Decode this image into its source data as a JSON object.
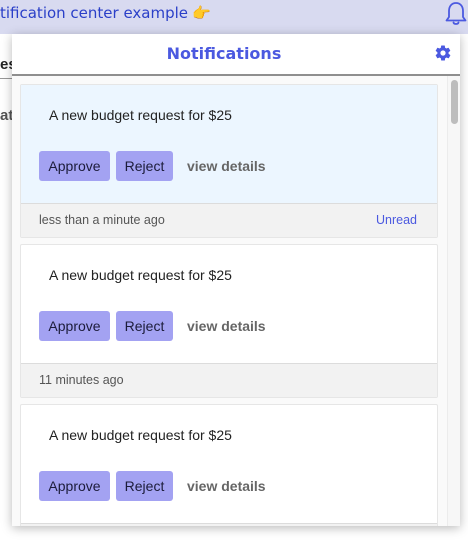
{
  "app": {
    "title": "tification center example",
    "title_emoji": "👉"
  },
  "background": {
    "fragment_1": "es",
    "fragment_2": "at"
  },
  "panel": {
    "title": "Notifications",
    "settings_icon": "gear-icon"
  },
  "notifications": [
    {
      "message": "A new budget request for $25",
      "approve_label": "Approve",
      "reject_label": "Reject",
      "details_label": "view details",
      "time": "less than a minute ago",
      "status": "Unread"
    },
    {
      "message": "A new budget request for $25",
      "approve_label": "Approve",
      "reject_label": "Reject",
      "details_label": "view details",
      "time": "11 minutes ago",
      "status": ""
    },
    {
      "message": "A new budget request for $25",
      "approve_label": "Approve",
      "reject_label": "Reject",
      "details_label": "view details",
      "time": "",
      "status": ""
    }
  ],
  "colors": {
    "accent": "#4b59e0",
    "button": "#a3a2f2",
    "unread_bg": "#ecf6ff",
    "topbar_bg": "#d8daf0"
  }
}
